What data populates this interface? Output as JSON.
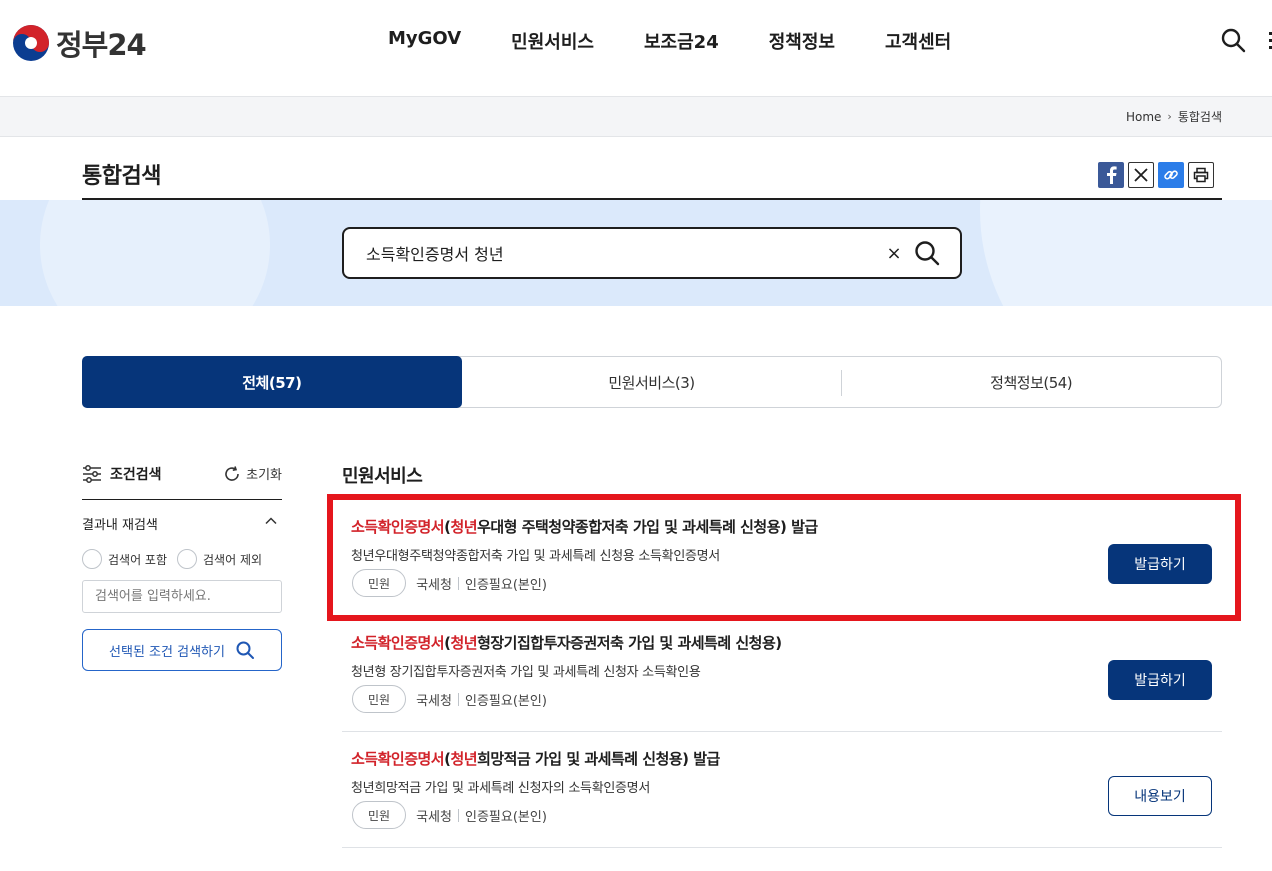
{
  "header": {
    "logo_text": "정부24",
    "nav": [
      "MyGOV",
      "민원서비스",
      "보조금24",
      "정책정보",
      "고객센터"
    ]
  },
  "breadcrumb": {
    "home": "Home",
    "current": "통합검색"
  },
  "page_title": "통합검색",
  "search": {
    "query": "소득확인증명서 청년",
    "clear_label": "×"
  },
  "tabs": [
    {
      "label": "전체(57)",
      "active": true
    },
    {
      "label": "민원서비스(3)",
      "active": false
    },
    {
      "label": "정책정보(54)",
      "active": false
    }
  ],
  "filter": {
    "title": "조건검색",
    "reset_label": "초기화",
    "refine_title": "결과내 재검색",
    "include_label": "검색어 포함",
    "exclude_label": "검색어 제외",
    "input_placeholder": "검색어를 입력하세요.",
    "submit_label": "선택된 조건 검색하기"
  },
  "section_title": "민원서비스",
  "results": [
    {
      "title_hl1": "소득확인증명서",
      "title_p1": "(",
      "title_hl2": "청년",
      "title_rest": "우대형 주택청약종합저축 가입 및 과세특례 신청용) 발급",
      "desc": "청년우대형주택청약종합저축 가입 및 과세특례 신청용 소득확인증명서",
      "chip": "민원",
      "agency": "국세청",
      "auth": "인증필요(본인)",
      "button": "발급하기"
    },
    {
      "title_hl1": "소득확인증명서",
      "title_p1": "(",
      "title_hl2": "청년",
      "title_rest": "형장기집합투자증권저축 가입 및 과세특례 신청용)",
      "desc": "청년형 장기집합투자증권저축 가입 및 과세특례 신청자 소득확인용",
      "chip": "민원",
      "agency": "국세청",
      "auth": "인증필요(본인)",
      "button": "발급하기"
    },
    {
      "title_hl1": "소득확인증명서",
      "title_p1": "(",
      "title_hl2": "청년",
      "title_rest": "희망적금 가입 및 과세특례 신청용) 발급",
      "desc": "청년희망적금 가입 및 과세특례 신청자의 소득확인증명서",
      "chip": "민원",
      "agency": "국세청",
      "auth": "인증필요(본인)",
      "button": "내용보기"
    }
  ],
  "colors": {
    "primary": "#06357a",
    "highlight_text": "#d2232a",
    "annotation_box": "#e5161d",
    "hero_bg": "#dbe9fb"
  },
  "icons": {
    "search": "search-icon",
    "filter": "sliders-icon",
    "reset": "refresh-icon",
    "chevron": "chevron-up-icon"
  }
}
